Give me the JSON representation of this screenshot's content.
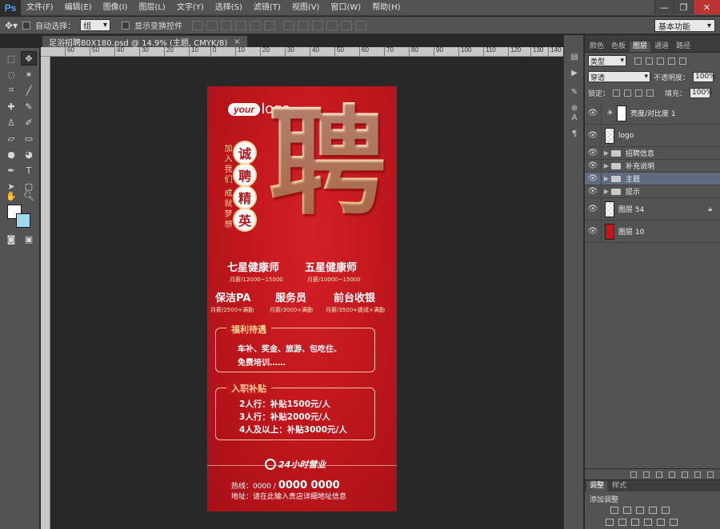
{
  "app": {
    "logo": "Ps"
  },
  "menu": [
    "文件(F)",
    "编辑(E)",
    "图像(I)",
    "图层(L)",
    "文字(Y)",
    "选择(S)",
    "滤镜(T)",
    "视图(V)",
    "窗口(W)",
    "帮助(H)"
  ],
  "window_controls": {
    "minimize": "—",
    "restore": "❐",
    "close": "✕"
  },
  "options": {
    "auto_select_label": "自动选择：",
    "auto_select_value": "组",
    "show_transform_label": "显示变换控件",
    "workspace": "基本功能"
  },
  "document": {
    "tab_title": "足浴招聘80X180.psd @ 14.9% (主题, CMYK/8)",
    "close": "×"
  },
  "ruler": {
    "ticks": [
      "60",
      "50",
      "40",
      "30",
      "20",
      "10",
      "0",
      "10",
      "20",
      "30",
      "40",
      "50",
      "60",
      "70",
      "80",
      "90",
      "100",
      "110",
      "120",
      "130",
      "140"
    ]
  },
  "colors": {
    "foreground": "#ffffff",
    "background": "#9fd9ee",
    "poster_red": "#c4161c",
    "gold": "#f7d9a6"
  },
  "panel": {
    "tabs": [
      "颜色",
      "色板",
      "图层",
      "通道",
      "路径"
    ],
    "active_tab": "图层",
    "filter_kind": "类型",
    "blend_mode": "穿透",
    "opacity_label": "不透明度：",
    "opacity_value": "100%",
    "lock_label": "锁定：",
    "fill_label": "填充：",
    "fill_value": "100%",
    "layers": [
      {
        "name": "亮度/对比度 1",
        "type": "adjustment"
      },
      {
        "name": "logo",
        "type": "smart"
      },
      {
        "name": "招聘信息",
        "type": "group"
      },
      {
        "name": "补充说明",
        "type": "group"
      },
      {
        "name": "主题",
        "type": "group",
        "selected": true
      },
      {
        "name": "提示",
        "type": "group"
      },
      {
        "name": "图层 54",
        "type": "checker",
        "locked": true
      },
      {
        "name": "图层 10",
        "type": "red"
      }
    ]
  },
  "adjustments": {
    "tabs": [
      "调整",
      "样式"
    ],
    "title": "添加调整"
  },
  "poster": {
    "logo_your": "your",
    "logo_text": "logo",
    "side_text_1": "加入我们",
    "side_text_2": "成就梦想",
    "big_char": "聘",
    "circle_chars": [
      "诚",
      "聘",
      "精",
      "英"
    ],
    "jobs_row1": [
      {
        "title": "七星健康师",
        "pay": "月薪/12000~15000"
      },
      {
        "title": "五星健康师",
        "pay": "月薪/10000~15000"
      }
    ],
    "jobs_row2": [
      {
        "title": "保洁PA",
        "pay": "月薪/2500+满勤"
      },
      {
        "title": "服务员",
        "pay": "月薪/3000+满勤"
      },
      {
        "title": "前台收银",
        "pay": "月薪/3500+提成+满勤"
      }
    ],
    "benefits": {
      "title": "福利待遇",
      "line1": "车补、奖金、旅游、包吃住、",
      "line2": "免费培训……"
    },
    "bonus": {
      "title": "入职补贴",
      "lines": [
        "2人行：补贴1500元/人",
        "3人行：补贴2000元/人",
        "4人及以上：补贴3000元/人"
      ]
    },
    "hours": "24小时营业",
    "hotline_label": "热线：0000 /",
    "hotline_number": "0000 0000",
    "address": "地址：请在此输入贵店详细地址信息"
  }
}
